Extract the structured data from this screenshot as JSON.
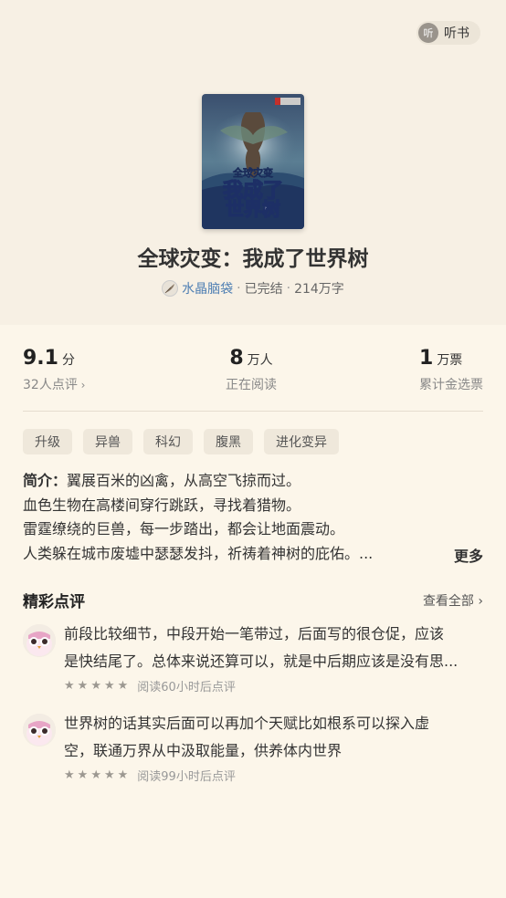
{
  "header": {
    "listen_icon_text": "听",
    "listen_label": "听书"
  },
  "book": {
    "cover_text_top": "全球灾变",
    "cover_text_main": "我成了",
    "cover_text_main2": "世界树",
    "title": "全球灾变：我成了世界树",
    "author": "水晶脑袋",
    "status": "已完结",
    "word_count": "214万字"
  },
  "stats": {
    "rating_value": "9.1",
    "rating_unit": "分",
    "rating_sub": "32人点评",
    "readers_value": "8",
    "readers_unit": "万人",
    "readers_sub": "正在阅读",
    "votes_value": "1",
    "votes_unit": "万票",
    "votes_sub": "累计金选票"
  },
  "tags": [
    "升级",
    "异兽",
    "科幻",
    "腹黑",
    "进化变异"
  ],
  "intro": {
    "label": "简介：",
    "lines": [
      "翼展百米的凶禽，从高空飞掠而过。",
      "血色生物在高楼间穿行跳跃，寻找着猎物。",
      "雷霆缭绕的巨兽，每一步踏出，都会让地面震动。",
      "人类躲在城市废墟中瑟瑟发抖，祈祷着神树的庇佑。..."
    ],
    "more_label": "更多"
  },
  "reviews_section": {
    "title": "精彩点评",
    "view_all": "查看全部"
  },
  "reviews": [
    {
      "lines": [
        "前段比较细节，中段开始一笔带过，后面写的很仓促，应该",
        "是快结尾了。总体来说还算可以，就是中后期应该是没有思..."
      ],
      "meta": "阅读60小时后点评"
    },
    {
      "lines": [
        "世界树的话其实后面可以再加个天赋比如根系可以探入虚",
        "空，联通万界从中汲取能量，供养体内世界"
      ],
      "meta": "阅读99小时后点评"
    }
  ]
}
